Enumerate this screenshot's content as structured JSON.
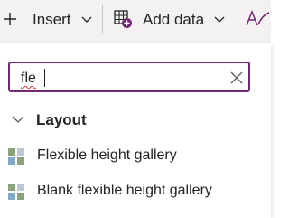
{
  "toolbar": {
    "insert_label": "Insert",
    "add_data_label": "Add data",
    "insert_icon": "plus-icon",
    "add_data_icon": "table-add-icon",
    "theme_icon": "text-style-icon"
  },
  "search": {
    "value": "fle",
    "clear_icon": "close-icon"
  },
  "group": {
    "label": "Layout",
    "icon": "chevron-down-icon"
  },
  "results": [
    {
      "label": "Flexible height gallery",
      "icon": "gallery-icon"
    },
    {
      "label": "Blank flexible height gallery",
      "icon": "gallery-icon"
    }
  ],
  "colors": {
    "accent": "#742774",
    "toolbar_bg": "#f3f2f1",
    "text": "#252423",
    "spellcheck": "#d13438"
  }
}
